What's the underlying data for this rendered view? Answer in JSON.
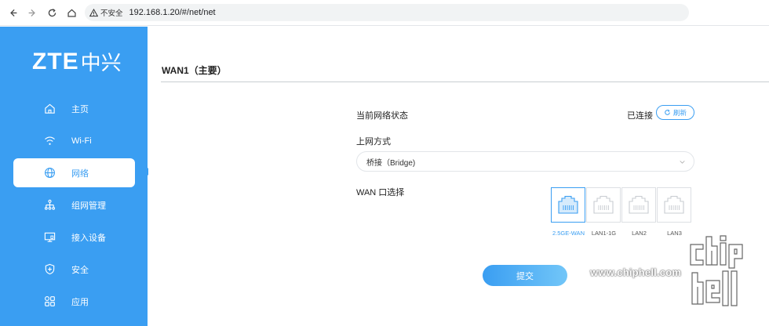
{
  "browser": {
    "security_label": "不安全",
    "url": "192.168.1.20/#/net/net"
  },
  "sidebar": {
    "logo_text": "ZTE",
    "logo_cn": "中兴",
    "items": [
      {
        "label": "主页",
        "icon": "home-icon",
        "active": false
      },
      {
        "label": "Wi-Fi",
        "icon": "wifi-icon",
        "active": false
      },
      {
        "label": "网络",
        "icon": "globe-icon",
        "active": true
      },
      {
        "label": "组网管理",
        "icon": "network-tree-icon",
        "active": false
      },
      {
        "label": "接入设备",
        "icon": "monitor-icon",
        "active": false
      },
      {
        "label": "安全",
        "icon": "shield-icon",
        "active": false
      },
      {
        "label": "应用",
        "icon": "apps-grid-icon",
        "active": false
      }
    ]
  },
  "main": {
    "title": "WAN1（主要）",
    "status": {
      "label": "当前网络状态",
      "value": "已连接",
      "refresh_label": "刷新"
    },
    "mode": {
      "label": "上网方式",
      "selected": "桥接（Bridge)"
    },
    "wan_port": {
      "label": "WAN 口选择",
      "ports": [
        {
          "label": "2.5GE-WAN",
          "selected": true
        },
        {
          "label": "LAN1-1G",
          "selected": false
        },
        {
          "label": "LAN2",
          "selected": false
        },
        {
          "label": "LAN3",
          "selected": false
        }
      ]
    },
    "submit_label": "提交"
  },
  "watermark": {
    "text": "www.chiphell.com"
  },
  "colors": {
    "accent": "#3a9ef2",
    "sidebar_bg": "#3a9ef2"
  }
}
